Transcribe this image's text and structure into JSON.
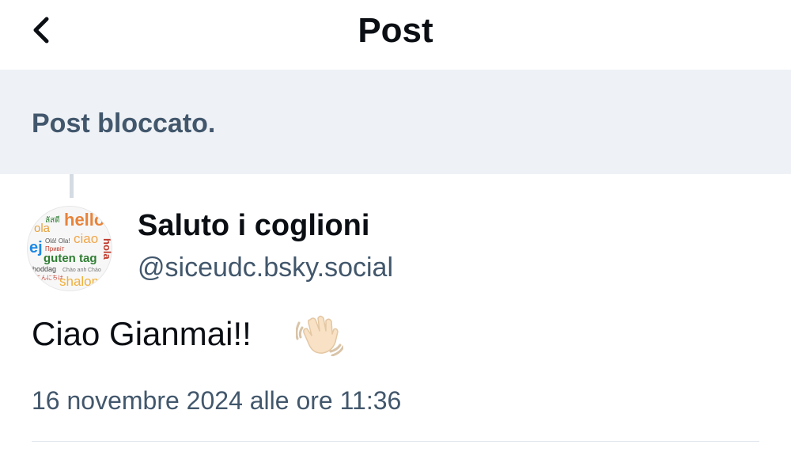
{
  "header": {
    "title": "Post",
    "back_icon": "chevron-left-icon"
  },
  "banner": {
    "text": "Post bloccato."
  },
  "author": {
    "display_name": "Saluto i coglioni",
    "handle": "@siceudc.bsky.social",
    "avatar_words": [
      "hello",
      "ola",
      "ciao",
      "hola",
      "guten tag",
      "shalom",
      "Olá! Ola!",
      "Привіт",
      "hoddag",
      "Chào anh",
      "こんにちは"
    ]
  },
  "post": {
    "text": "Ciao Gianmai!!",
    "emoji_icon": "waving-hand-icon",
    "timestamp": "16 novembre 2024 alle ore 11:36"
  },
  "colors": {
    "text_primary": "#0b0f14",
    "text_secondary": "#42576c",
    "banner_bg": "#eef1f5",
    "divider": "#dde3ea"
  }
}
